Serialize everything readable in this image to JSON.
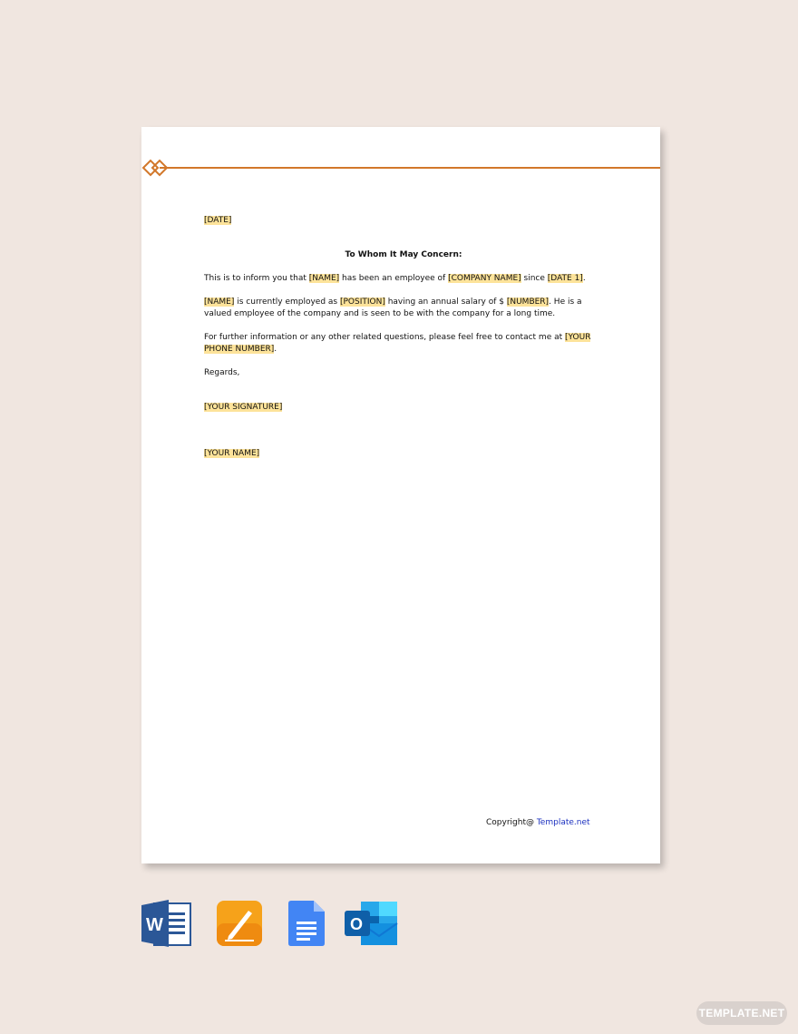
{
  "letter": {
    "date": "[DATE]",
    "salutation": "To Whom It May Concern:",
    "p1": {
      "a": "This is to inform you that ",
      "name": "[NAME]",
      "b": " has been an employee of ",
      "company": "[COMPANY NAME]",
      "c": " since ",
      "date1": "[DATE 1]",
      "d": "."
    },
    "p2": {
      "name": "[NAME]",
      "a": " is currently employed as ",
      "position": "[POSITION]",
      "b": " having an annual salary of $ ",
      "number": "[NUMBER]",
      "c": ". He is a valued employee of the company and is seen to be with the company for a long time."
    },
    "p3": {
      "a": "For further information or any other related questions, please feel free to contact me at ",
      "phone": "[YOUR PHONE NUMBER]",
      "b": "."
    },
    "closing": "Regards,",
    "signature": "[YOUR SIGNATURE]",
    "your_name": "[YOUR NAME]"
  },
  "footer": {
    "copyright_label": "Copyright@ ",
    "copyright_link": "Template.net"
  },
  "app_icons": [
    {
      "name": "word-icon",
      "letter": "W"
    },
    {
      "name": "pages-icon"
    },
    {
      "name": "google-docs-icon"
    },
    {
      "name": "outlook-icon",
      "letter": "O"
    }
  ],
  "badge": "TEMPLATE.NET",
  "colors": {
    "background": "#f0e6e0",
    "accent_orange": "#d2772a",
    "highlight": "#fde39a",
    "link_blue": "#1a2fbf"
  }
}
